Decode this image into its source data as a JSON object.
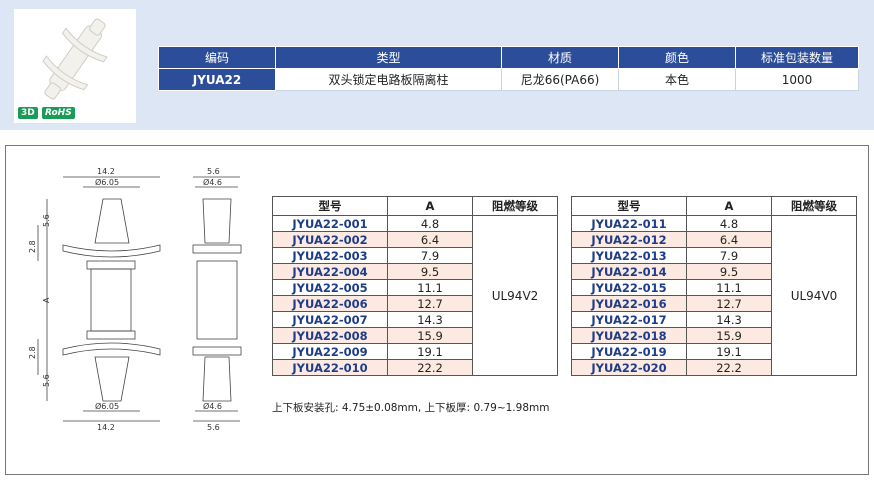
{
  "badges": {
    "three_d": "3D",
    "rohs": "RoHS"
  },
  "spec": {
    "headers": [
      "编码",
      "类型",
      "材质",
      "颜色",
      "标准包装数量"
    ],
    "row": [
      "JYUA22",
      "双头锁定电路板隔离柱",
      "尼龙66(PA66)",
      "本色",
      "1000"
    ]
  },
  "drawing_labels": {
    "top_width": "14.2",
    "top_dia": "Ø6.05",
    "side_width": "5.6",
    "side_dia": "Ø4.6",
    "dim_56": "5.6",
    "dim_28": "2.8",
    "dim_a": "A",
    "bot_width": "14.2",
    "bot_dia": "Ø6.05",
    "bot_side_width": "5.6",
    "bot_side_dia": "Ø4.6"
  },
  "table_left": {
    "headers": [
      "型号",
      "A",
      "阻燃等级"
    ],
    "rating": "UL94V2",
    "rows": [
      {
        "model": "JYUA22-001",
        "a": "4.8"
      },
      {
        "model": "JYUA22-002",
        "a": "6.4"
      },
      {
        "model": "JYUA22-003",
        "a": "7.9"
      },
      {
        "model": "JYUA22-004",
        "a": "9.5"
      },
      {
        "model": "JYUA22-005",
        "a": "11.1"
      },
      {
        "model": "JYUA22-006",
        "a": "12.7"
      },
      {
        "model": "JYUA22-007",
        "a": "14.3"
      },
      {
        "model": "JYUA22-008",
        "a": "15.9"
      },
      {
        "model": "JYUA22-009",
        "a": "19.1"
      },
      {
        "model": "JYUA22-010",
        "a": "22.2"
      }
    ]
  },
  "table_right": {
    "headers": [
      "型号",
      "A",
      "阻燃等级"
    ],
    "rating": "UL94V0",
    "rows": [
      {
        "model": "JYUA22-011",
        "a": "4.8"
      },
      {
        "model": "JYUA22-012",
        "a": "6.4"
      },
      {
        "model": "JYUA22-013",
        "a": "7.9"
      },
      {
        "model": "JYUA22-014",
        "a": "9.5"
      },
      {
        "model": "JYUA22-015",
        "a": "11.1"
      },
      {
        "model": "JYUA22-016",
        "a": "12.7"
      },
      {
        "model": "JYUA22-017",
        "a": "14.3"
      },
      {
        "model": "JYUA22-018",
        "a": "15.9"
      },
      {
        "model": "JYUA22-019",
        "a": "19.1"
      },
      {
        "model": "JYUA22-020",
        "a": "22.2"
      }
    ]
  },
  "note": "上下板安装孔: 4.75±0.08mm, 上下板厚: 0.79~1.98mm"
}
